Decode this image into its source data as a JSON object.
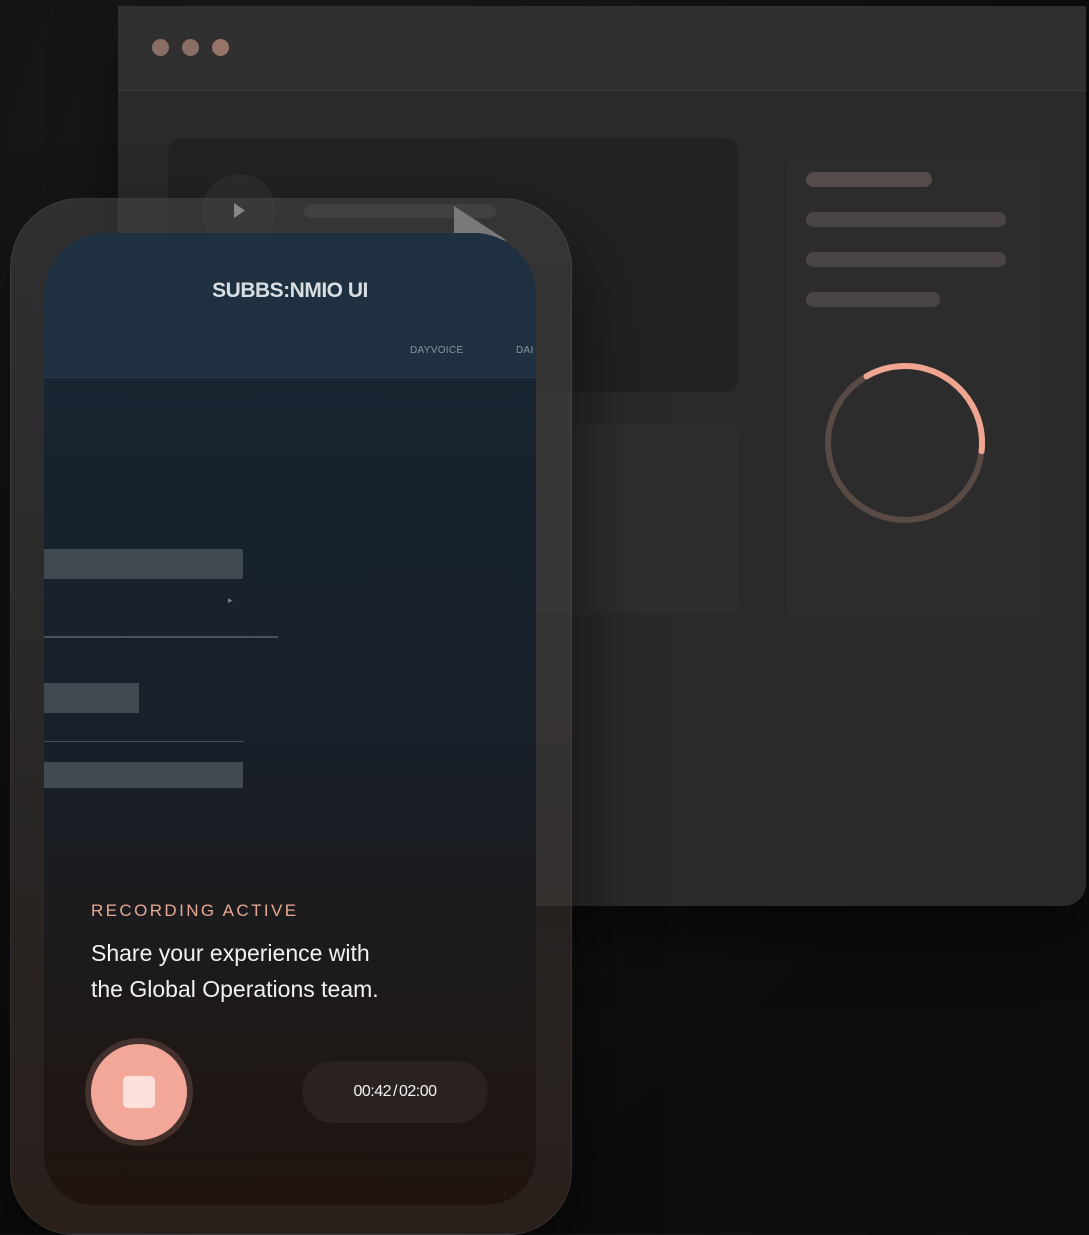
{
  "app": {
    "title": "SUBBS:NMIO UI"
  },
  "nav": {
    "items": [
      "DAYVOICE",
      "DAI"
    ]
  },
  "recording": {
    "status_label": "RECORDING ACTIVE",
    "message_line1": "Share your experience with",
    "message_line2": "the Global Operations team.",
    "elapsed": "00:42",
    "separator": "/",
    "total": "02:00",
    "progress_fraction": 0.35
  },
  "colors": {
    "accent": "#f3a799",
    "status_text": "#e8a993",
    "window_dot": "#8a6d64"
  },
  "icons": {
    "stop": "stop-icon",
    "play": "play-icon"
  }
}
